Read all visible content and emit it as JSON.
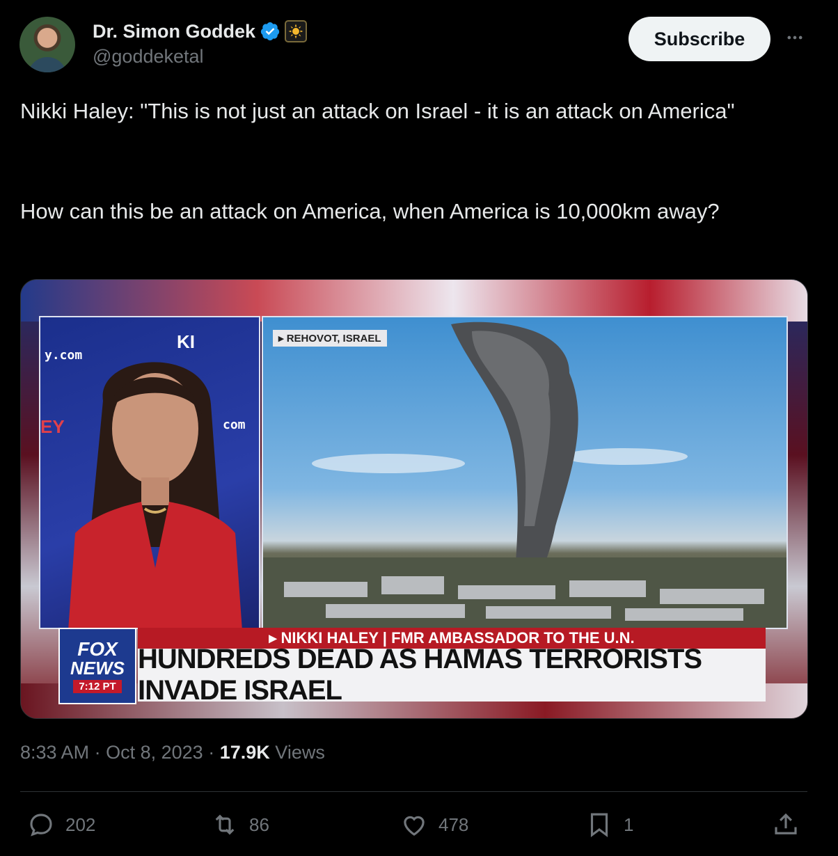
{
  "author": {
    "name": "Dr. Simon Goddek",
    "handle": "@goddeketal",
    "verified_icon": "verified-check-icon",
    "badge_icon": "sun-badge-icon"
  },
  "header": {
    "subscribe_label": "Subscribe",
    "more_icon": "more-dots-icon"
  },
  "tweet": {
    "line1": "Nikki Haley: \"This is not just an attack on Israel - it is an attack on America\"",
    "line2": "How can this be an attack on America, when America is 10,000km away?"
  },
  "media": {
    "location_tag": "▸ REHOVOT, ISRAEL",
    "network_line1": "FOX",
    "network_line2": "NEWS",
    "clock": "7:12 PT",
    "name_strip": "▸ NIKKI HALEY | FMR AMBASSADOR TO THE U.N.",
    "headline": "HUNDREDS DEAD AS HAMAS TERRORISTS INVADE ISRAEL",
    "bg_text_1": "y.com",
    "bg_text_2": "com",
    "bg_text_3": "KI",
    "bg_text_4": "EY"
  },
  "meta": {
    "time": "8:33 AM",
    "date": "Oct 8, 2023",
    "sep": "·",
    "views_count": "17.9K",
    "views_label": "Views"
  },
  "actions": {
    "replies": "202",
    "reposts": "86",
    "likes": "478",
    "bookmarks": "1"
  },
  "colors": {
    "background": "#000000",
    "text": "#e7e9ea",
    "muted": "#71767b",
    "verified": "#1d9bf0"
  }
}
